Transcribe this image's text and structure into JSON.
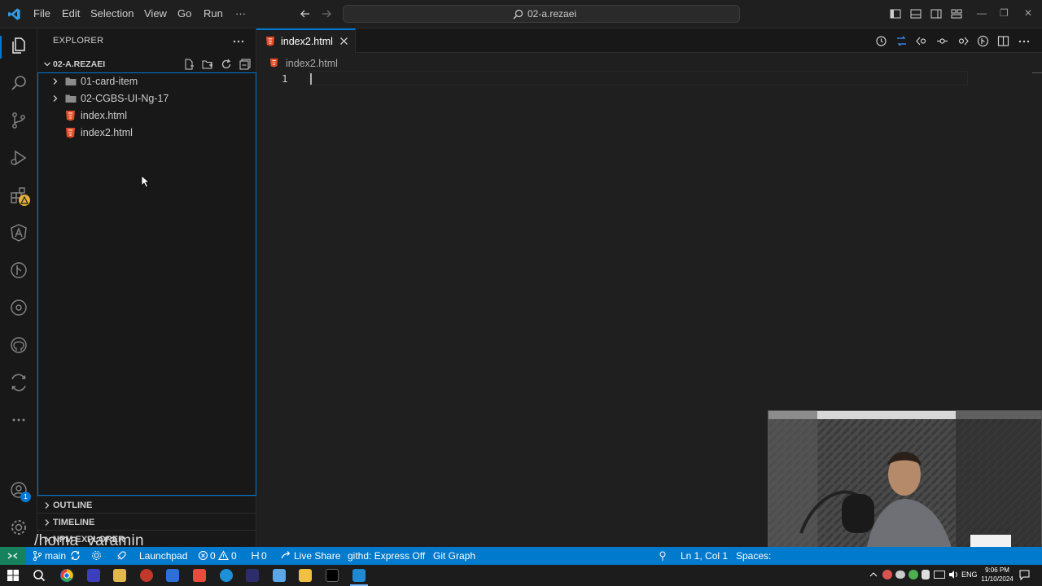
{
  "titlebar": {
    "menu": [
      "File",
      "Edit",
      "Selection",
      "View",
      "Go",
      "Run",
      "···"
    ],
    "search_text": "02-a.rezaei"
  },
  "sidebar": {
    "title": "EXPLORER",
    "root": "02-A.REZAEI",
    "items": [
      {
        "label": "01-card-item",
        "type": "folder"
      },
      {
        "label": "02-CGBS-UI-Ng-17",
        "type": "folder"
      },
      {
        "label": "index.html",
        "type": "html"
      },
      {
        "label": "index2.html",
        "type": "html"
      }
    ],
    "sections": [
      "OUTLINE",
      "TIMELINE",
      "NPM EXPLORER"
    ]
  },
  "editor": {
    "tab_label": "index2.html",
    "breadcrumb": "index2.html",
    "line_number": "1"
  },
  "statusbar": {
    "branch": "main",
    "launchpad": "Launchpad",
    "errors": "0",
    "warnings": "0",
    "ports": "0",
    "live_share": "Live Share",
    "githd": "githd: Express Off",
    "git_graph": "Git Graph",
    "cursor": "Ln 1, Col 1",
    "spaces": "Spaces:"
  },
  "taskbar": {
    "lang": "ENG",
    "time": "9:06 PM",
    "date": "11/10/2024"
  },
  "overlay": {
    "watermark": "/homa_varamin"
  },
  "colors": {
    "accent": "#0078d4",
    "status": "#007acc",
    "html_icon": "#e44d26"
  }
}
